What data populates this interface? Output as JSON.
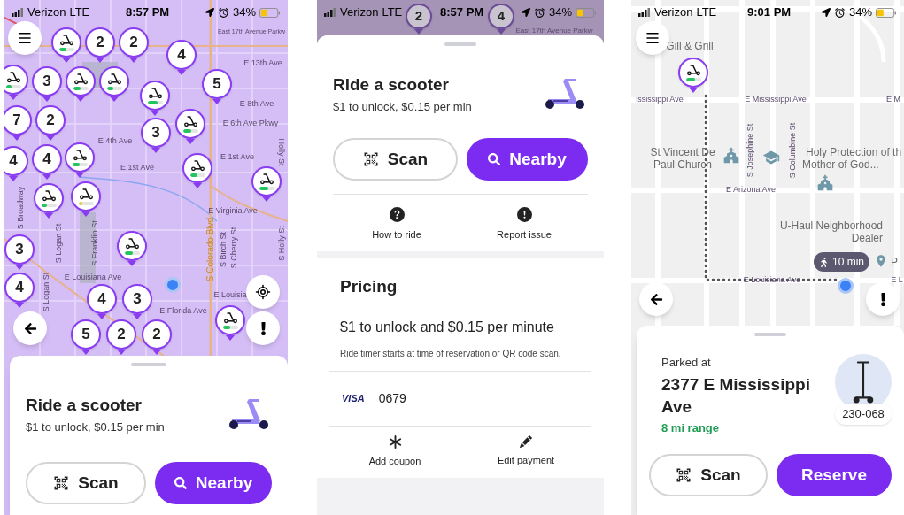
{
  "map_screen": {
    "status_bar": {
      "carrier": "Verizon",
      "network": "LTE",
      "time": "8:57 PM",
      "battery": "34%"
    },
    "markers": [
      {
        "kind": "scooter",
        "level": 0.5
      },
      {
        "kind": "count",
        "label": "2"
      },
      {
        "kind": "count",
        "label": "2"
      },
      {
        "kind": "count",
        "label": "4"
      },
      {
        "kind": "scooter",
        "level": 0.4
      },
      {
        "kind": "count",
        "label": "3"
      },
      {
        "kind": "scooter",
        "level": 0.5
      },
      {
        "kind": "scooter",
        "level": 0.45
      },
      {
        "kind": "count",
        "label": "5"
      },
      {
        "kind": "scooter",
        "level": 0.7
      },
      {
        "kind": "count",
        "label": "7"
      },
      {
        "kind": "count",
        "label": "2"
      },
      {
        "kind": "scooter",
        "level": 0.55
      },
      {
        "kind": "count",
        "label": "3"
      },
      {
        "kind": "count",
        "label": "4"
      },
      {
        "kind": "count",
        "label": "4"
      },
      {
        "kind": "scooter",
        "level": 0.5
      },
      {
        "kind": "scooter",
        "level": 0.5
      },
      {
        "kind": "scooter",
        "level": 0.6
      },
      {
        "kind": "scooter",
        "level": 0.4
      },
      {
        "kind": "scooter",
        "level": 0.25
      },
      {
        "kind": "scooter",
        "level": 0.55
      },
      {
        "kind": "count",
        "label": "3"
      },
      {
        "kind": "count",
        "label": "4"
      },
      {
        "kind": "count",
        "label": "4"
      },
      {
        "kind": "count",
        "label": "3"
      },
      {
        "kind": "scooter",
        "level": 0.5
      },
      {
        "kind": "count",
        "label": "5"
      },
      {
        "kind": "count",
        "label": "2"
      },
      {
        "kind": "count",
        "label": "2"
      }
    ],
    "map_labels": [
      "East 17th Avenue Parkw",
      "E 13th Ave",
      "E 8th Ave",
      "E 6th Ave Pkwy",
      "Holly St",
      "E 4th Ave",
      "E 1st Ave",
      "E 1st Ave",
      "S Broadway",
      "S Logan St",
      "E Virginia Ave",
      "S Franklin St",
      "S Colorado Blvd",
      "S Birch St",
      "S Cherry St",
      "S Holly St",
      "E Louisiana Ave",
      "E Louisia",
      "E Florida Ave",
      "S Logan St"
    ],
    "sheet": {
      "title": "Ride a scooter",
      "subtitle": "$1 to unlock, $0.15 per min",
      "buttons": [
        {
          "kind": "scan",
          "label": "Scan"
        },
        {
          "kind": "nearby",
          "label": "Nearby"
        }
      ]
    }
  },
  "detail_screen": {
    "status_bar": {
      "carrier": "Verizon",
      "network": "LTE",
      "time": "8:57 PM",
      "battery": "34%"
    },
    "markers": [
      {
        "kind": "count",
        "label": "2"
      },
      {
        "kind": "count",
        "label": "4"
      }
    ],
    "map_labels": [
      "East 17th Avenue Parkw"
    ],
    "sheet": {
      "title": "Ride a scooter",
      "subtitle": "$1 to unlock, $0.15 per min",
      "buttons": [
        {
          "kind": "scan",
          "label": "Scan"
        },
        {
          "kind": "nearby",
          "label": "Nearby"
        }
      ],
      "actions": [
        {
          "kind": "help",
          "label": "How to ride"
        },
        {
          "kind": "report",
          "label": "Report issue"
        }
      ],
      "pricing": {
        "title": "Pricing",
        "rate": "$1 to unlock and $0.15 per minute",
        "note": "Ride timer starts at time of reservation or QR code scan.",
        "card_brand": "VISA",
        "card_number": "0679"
      },
      "payment_actions": [
        {
          "kind": "coupon",
          "label": "Add coupon"
        },
        {
          "kind": "edit",
          "label": "Edit payment"
        }
      ]
    }
  },
  "parked_screen": {
    "status_bar": {
      "carrier": "Verizon",
      "network": "LTE",
      "time": "9:01 PM",
      "battery": "34%"
    },
    "markers": [
      {
        "kind": "scooter",
        "level": 0.6
      }
    ],
    "map_labels": [
      "Gill & Grill",
      "ississippi Ave",
      "E Mississippi Ave",
      "E M",
      "S Josephine St",
      "S Columbine St",
      "St Vincent De Paul Church",
      "Holy Protection of th",
      "Mother of God...",
      "E Arizona Ave",
      "U-Haul Neighborhood Dealer",
      "P",
      "E Louisiana Ave",
      "E L"
    ],
    "walk_time": "10 min",
    "card": {
      "label": "Parked at",
      "address": "2377 E Mississippi Ave",
      "range": "8 mi range",
      "scooter_id": "230-068",
      "buttons": [
        {
          "kind": "scan",
          "label": "Scan"
        },
        {
          "kind": "reserve",
          "label": "Reserve"
        }
      ]
    }
  }
}
